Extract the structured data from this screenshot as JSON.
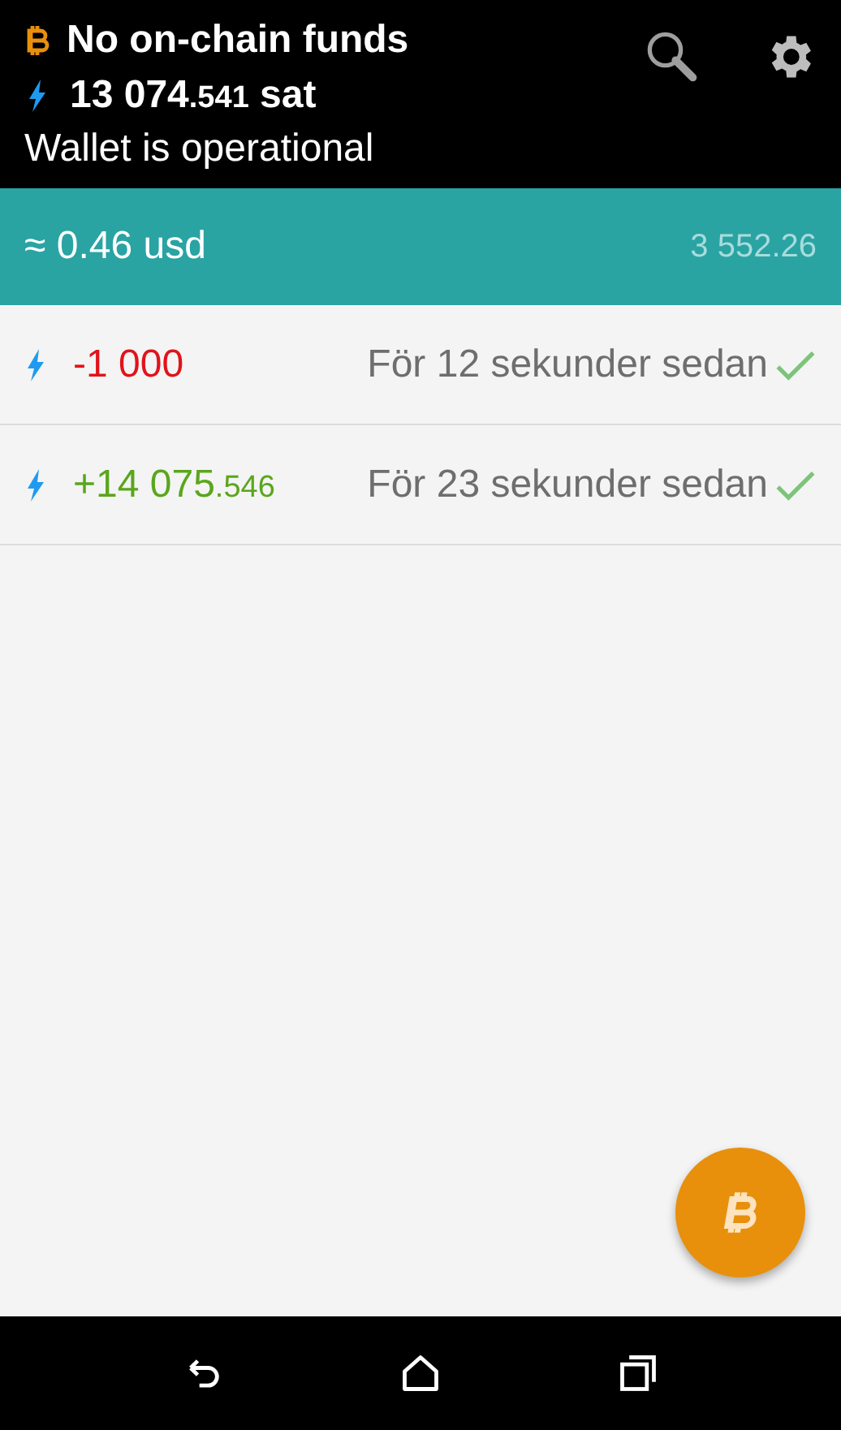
{
  "header": {
    "onchain": "No on-chain funds",
    "lightning": {
      "amount": "13 074",
      "fraction": ".541",
      "unit": "sat"
    },
    "status": "Wallet is operational"
  },
  "fiat_bar": {
    "approx": "≈ 0.46 usd",
    "rate": "3 552.26"
  },
  "transactions": [
    {
      "kind": "sent",
      "amount": "-1 000",
      "time": "För 12 sekunder sedan",
      "confirmed": true
    },
    {
      "kind": "received",
      "amount": "+14 075",
      "fraction": ".546",
      "time": "För 23 sekunder sedan",
      "confirmed": true
    }
  ]
}
